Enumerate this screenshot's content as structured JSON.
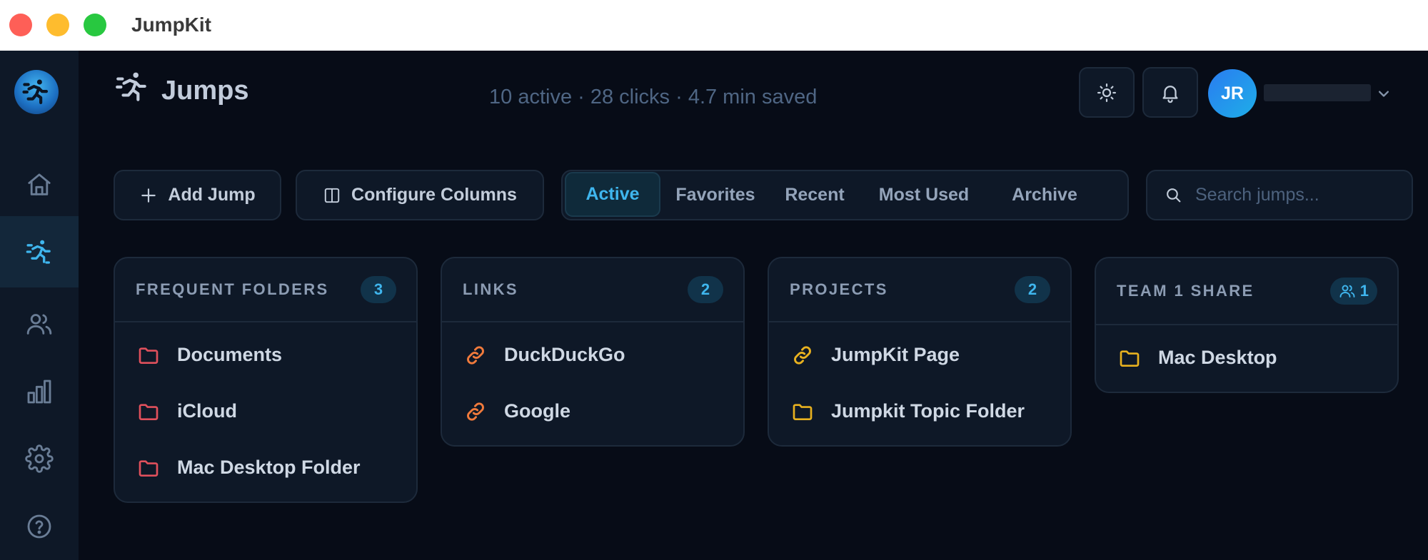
{
  "window": {
    "title": "JumpKit",
    "controls": {
      "close": "#fe5f57",
      "minimize": "#febc2e",
      "maximize": "#28c840"
    }
  },
  "sidebar": {
    "logo_icon": "running-person-logo",
    "items": [
      {
        "id": "home",
        "icon": "home-icon",
        "active": false
      },
      {
        "id": "jumps",
        "icon": "running-person-icon",
        "active": true
      },
      {
        "id": "users",
        "icon": "users-icon",
        "active": false
      },
      {
        "id": "analytics",
        "icon": "bar-chart-icon",
        "active": false
      },
      {
        "id": "settings",
        "icon": "gear-icon",
        "active": false
      },
      {
        "id": "help",
        "icon": "help-circle-icon",
        "active": false
      }
    ]
  },
  "header": {
    "title": "Jumps",
    "title_icon": "running-person-icon",
    "stats": "10 active · 28 clicks · 4.7 min saved",
    "user": {
      "initials": "JR",
      "name_redacted": true
    }
  },
  "toolbar": {
    "add_label": "Add Jump",
    "configure_label": "Configure Columns",
    "search_placeholder": "Search jumps..."
  },
  "tabs": [
    {
      "label": "Active",
      "active": true
    },
    {
      "label": "Favorites",
      "active": false
    },
    {
      "label": "Recent",
      "active": false
    },
    {
      "label": "Most Used",
      "active": false
    },
    {
      "label": "Archive",
      "active": false
    }
  ],
  "cards": [
    {
      "title": "FREQUENT FOLDERS",
      "count": "3",
      "items": [
        {
          "label": "Documents",
          "icon": "folder-icon",
          "color": "#e0505c"
        },
        {
          "label": "iCloud",
          "icon": "folder-icon",
          "color": "#e0505c"
        },
        {
          "label": "Mac Desktop Folder",
          "icon": "folder-icon",
          "color": "#e0505c"
        }
      ]
    },
    {
      "title": "LINKS",
      "count": "2",
      "items": [
        {
          "label": "DuckDuckGo",
          "icon": "link-icon",
          "color": "#f07a3c"
        },
        {
          "label": "Google",
          "icon": "link-icon",
          "color": "#f07a3c"
        }
      ]
    },
    {
      "title": "PROJECTS",
      "count": "2",
      "items": [
        {
          "label": "JumpKit Page",
          "icon": "link-icon",
          "color": "#e8b11f"
        },
        {
          "label": "Jumpkit Topic Folder",
          "icon": "folder-icon",
          "color": "#e8b11f"
        }
      ]
    },
    {
      "title": "TEAM 1 SHARE",
      "count": "1",
      "count_icon": "users-icon",
      "items": [
        {
          "label": "Mac Desktop",
          "icon": "folder-icon",
          "color": "#e8b11f"
        }
      ]
    }
  ],
  "colors": {
    "accent": "#3fb6ee",
    "background": "#070c17",
    "panel": "#0e1827",
    "border": "#1d2a3b"
  }
}
